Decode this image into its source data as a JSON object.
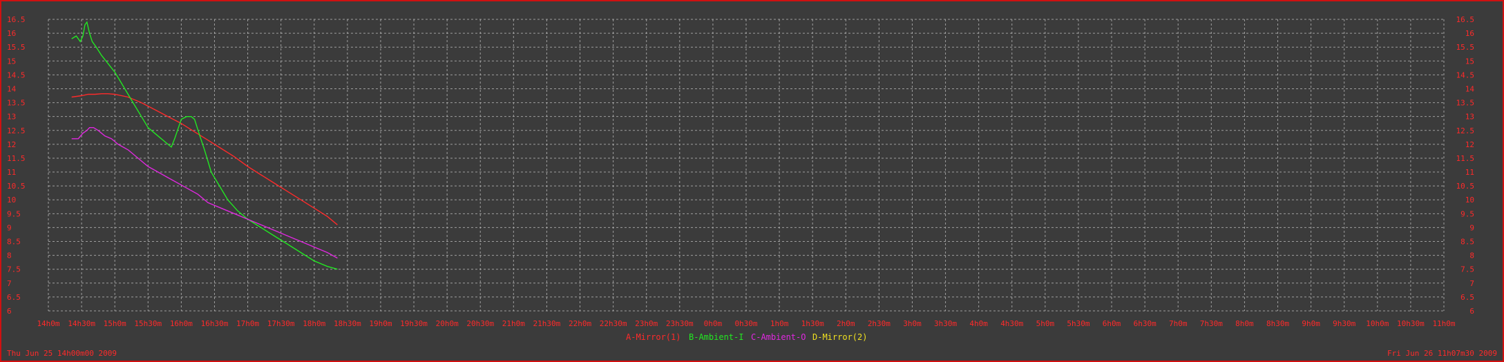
{
  "chart_data": {
    "type": "line",
    "title": "",
    "xlabel": "",
    "ylabel": "",
    "ylim": [
      6,
      16.5
    ],
    "grid": true,
    "legend_placement": "bottom-center",
    "yticks": [
      "6",
      "6.5",
      "7",
      "7.5",
      "8",
      "8.5",
      "9",
      "9.5",
      "10",
      "10.5",
      "11",
      "11.5",
      "12",
      "12.5",
      "13",
      "13.5",
      "14",
      "14.5",
      "15",
      "15.5",
      "16",
      "16.5"
    ],
    "xticks": [
      "14h0m",
      "14h30m",
      "15h0m",
      "15h30m",
      "16h0m",
      "16h30m",
      "17h0m",
      "17h30m",
      "18h0m",
      "18h30m",
      "19h0m",
      "19h30m",
      "20h0m",
      "20h30m",
      "21h0m",
      "21h30m",
      "22h0m",
      "22h30m",
      "23h0m",
      "23h30m",
      "0h0m",
      "0h30m",
      "1h0m",
      "1h30m",
      "2h0m",
      "2h30m",
      "3h0m",
      "3h30m",
      "4h0m",
      "4h30m",
      "5h0m",
      "5h30m",
      "6h0m",
      "6h30m",
      "7h0m",
      "7h30m",
      "8h0m",
      "8h30m",
      "9h0m",
      "9h30m",
      "10h0m",
      "10h30m",
      "11h0m"
    ],
    "x_unit": "hours since 14h0m",
    "series": [
      {
        "name": "A-Mirror(1)",
        "color": "#ff2a2a",
        "x": [
          0.35,
          0.5,
          0.6,
          0.7,
          0.8,
          0.9,
          1.0,
          1.2,
          1.4,
          1.6,
          1.8,
          2.0,
          2.2,
          2.4,
          2.6,
          2.8,
          3.0,
          3.2,
          3.4,
          3.6,
          3.8,
          4.0,
          4.2,
          4.35
        ],
        "y": [
          13.7,
          13.75,
          13.8,
          13.8,
          13.82,
          13.82,
          13.8,
          13.7,
          13.5,
          13.25,
          13.0,
          12.75,
          12.45,
          12.15,
          11.85,
          11.55,
          11.2,
          10.9,
          10.6,
          10.3,
          10.0,
          9.7,
          9.4,
          9.1
        ]
      },
      {
        "name": "B-Ambient-I",
        "color": "#22e822",
        "x": [
          0.35,
          0.42,
          0.48,
          0.52,
          0.55,
          0.58,
          0.62,
          0.66,
          0.72,
          0.8,
          0.9,
          1.0,
          1.1,
          1.2,
          1.3,
          1.4,
          1.5,
          1.6,
          1.7,
          1.8,
          1.85,
          1.9,
          2.0,
          2.08,
          2.15,
          2.2,
          2.28,
          2.35,
          2.45,
          2.55,
          2.7,
          2.85,
          3.0,
          3.2,
          3.4,
          3.6,
          3.8,
          4.0,
          4.2,
          4.35
        ],
        "y": [
          15.8,
          15.9,
          15.7,
          15.9,
          16.3,
          16.4,
          16.0,
          15.7,
          15.5,
          15.2,
          14.9,
          14.6,
          14.2,
          13.8,
          13.4,
          13.0,
          12.6,
          12.4,
          12.2,
          12.0,
          11.9,
          12.2,
          12.9,
          13.0,
          13.0,
          12.9,
          12.3,
          11.8,
          11.0,
          10.6,
          10.0,
          9.6,
          9.3,
          9.0,
          8.7,
          8.4,
          8.1,
          7.8,
          7.6,
          7.5
        ]
      },
      {
        "name": "C-Ambient-O",
        "color": "#e028e0",
        "x": [
          0.35,
          0.45,
          0.52,
          0.58,
          0.62,
          0.68,
          0.75,
          0.85,
          0.95,
          1.05,
          1.2,
          1.35,
          1.5,
          1.65,
          1.8,
          1.95,
          2.1,
          2.25,
          2.4,
          2.6,
          2.8,
          3.0,
          3.2,
          3.4,
          3.6,
          3.8,
          4.0,
          4.2,
          4.35
        ],
        "y": [
          12.2,
          12.2,
          12.4,
          12.5,
          12.6,
          12.6,
          12.5,
          12.3,
          12.2,
          12.0,
          11.8,
          11.5,
          11.2,
          11.0,
          10.8,
          10.6,
          10.4,
          10.2,
          9.9,
          9.7,
          9.5,
          9.3,
          9.1,
          8.9,
          8.7,
          8.5,
          8.3,
          8.1,
          7.9
        ]
      },
      {
        "name": "D-Mirror(2)",
        "color": "#f0e020",
        "x": [],
        "y": []
      }
    ]
  },
  "stamps": {
    "start": "Thu Jun 25 14h00m00 2009",
    "end": "Fri Jun 26 11h07m30 2009"
  }
}
